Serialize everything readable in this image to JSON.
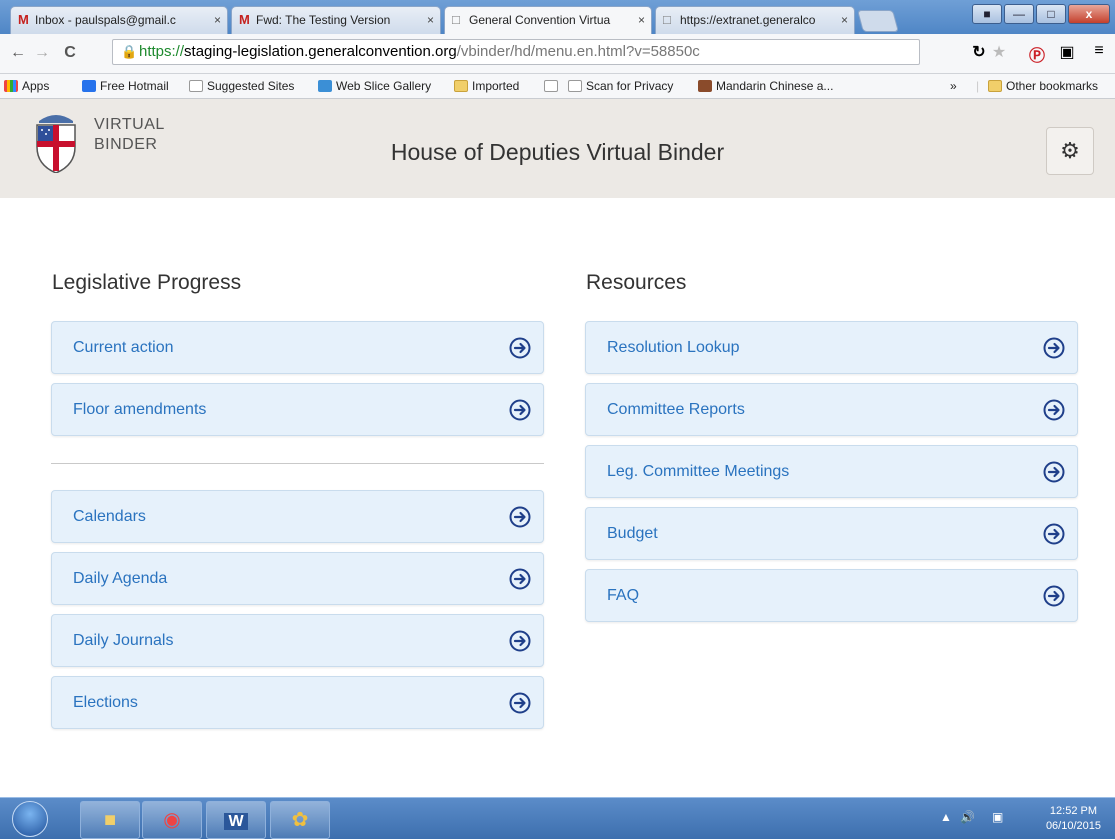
{
  "browser": {
    "tabs": [
      {
        "label": "Inbox - paulspals@gmail.c",
        "icon": "gmail-icon",
        "close": "×"
      },
      {
        "label": "Fwd: The Testing Version",
        "icon": "gmail-icon",
        "close": "×"
      },
      {
        "label": "General Convention Virtua",
        "icon": "page-icon",
        "close": "×"
      },
      {
        "label": "https://extranet.generalco",
        "icon": "page-icon",
        "close": "×"
      }
    ],
    "url": {
      "scheme": "https://",
      "host": "staging-legislation.generalconvention.org",
      "path": "/vbinder/hd/menu.en.html?v=58850c"
    },
    "bookmarks": [
      {
        "label": "Apps",
        "icon": "apps-grid-icon"
      },
      {
        "label": "Free Hotmail",
        "icon": "hotmail-icon"
      },
      {
        "label": "Suggested Sites",
        "icon": "page-icon"
      },
      {
        "label": "Web Slice Gallery",
        "icon": "ie-icon"
      },
      {
        "label": "Imported",
        "icon": "folder-icon"
      },
      {
        "label": "",
        "icon": "page-icon"
      },
      {
        "label": "Scan for Privacy",
        "icon": "page-icon"
      },
      {
        "label": "Mandarin Chinese a...",
        "icon": "mandarin-icon"
      }
    ],
    "bookmarks_more": "»",
    "other_bookmarks": "Other bookmarks"
  },
  "header": {
    "brand_line1": "VIRTUAL",
    "brand_line2": "BINDER",
    "title": "House of Deputies Virtual Binder"
  },
  "left": {
    "title": "Legislative Progress",
    "group1": [
      "Current action",
      "Floor amendments"
    ],
    "group2": [
      "Calendars",
      "Daily Agenda",
      "Daily Journals",
      "Elections"
    ]
  },
  "right": {
    "title": "Resources",
    "items": [
      "Resolution Lookup",
      "Committee Reports",
      "Leg. Committee Meetings",
      "Budget",
      "FAQ"
    ]
  },
  "taskbar": {
    "time": "12:52 PM",
    "date": "06/10/2015"
  },
  "colors": {
    "accent": "#2a73bf",
    "item_bg": "#e6f1fb",
    "header_bg": "#ece9e5"
  }
}
